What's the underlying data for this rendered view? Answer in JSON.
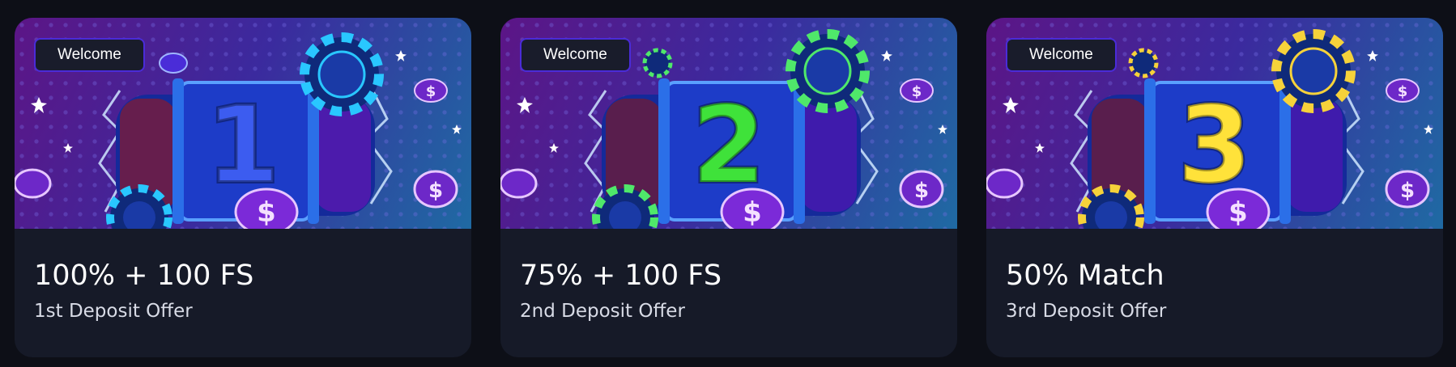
{
  "offers": [
    {
      "badge": "Welcome",
      "title": "100% + 100 FS",
      "subtitle": "1st Deposit Offer",
      "digit": "1",
      "digit_color": "#3c5cf0",
      "chip_color": "#29c7ff"
    },
    {
      "badge": "Welcome",
      "title": "75% + 100 FS",
      "subtitle": "2nd Deposit Offer",
      "digit": "2",
      "digit_color": "#3fe23a",
      "chip_color": "#4fe86a"
    },
    {
      "badge": "Welcome",
      "title": "50% Match",
      "subtitle": "3rd Deposit Offer",
      "digit": "3",
      "digit_color": "#ffe23a",
      "chip_color": "#f6d23a"
    }
  ],
  "icons": {
    "banner_art": "slot-reels-with-chips-illustration",
    "coin": "purple-dollar-coin-icon",
    "star": "star-icon",
    "chip": "poker-chip-icon"
  }
}
